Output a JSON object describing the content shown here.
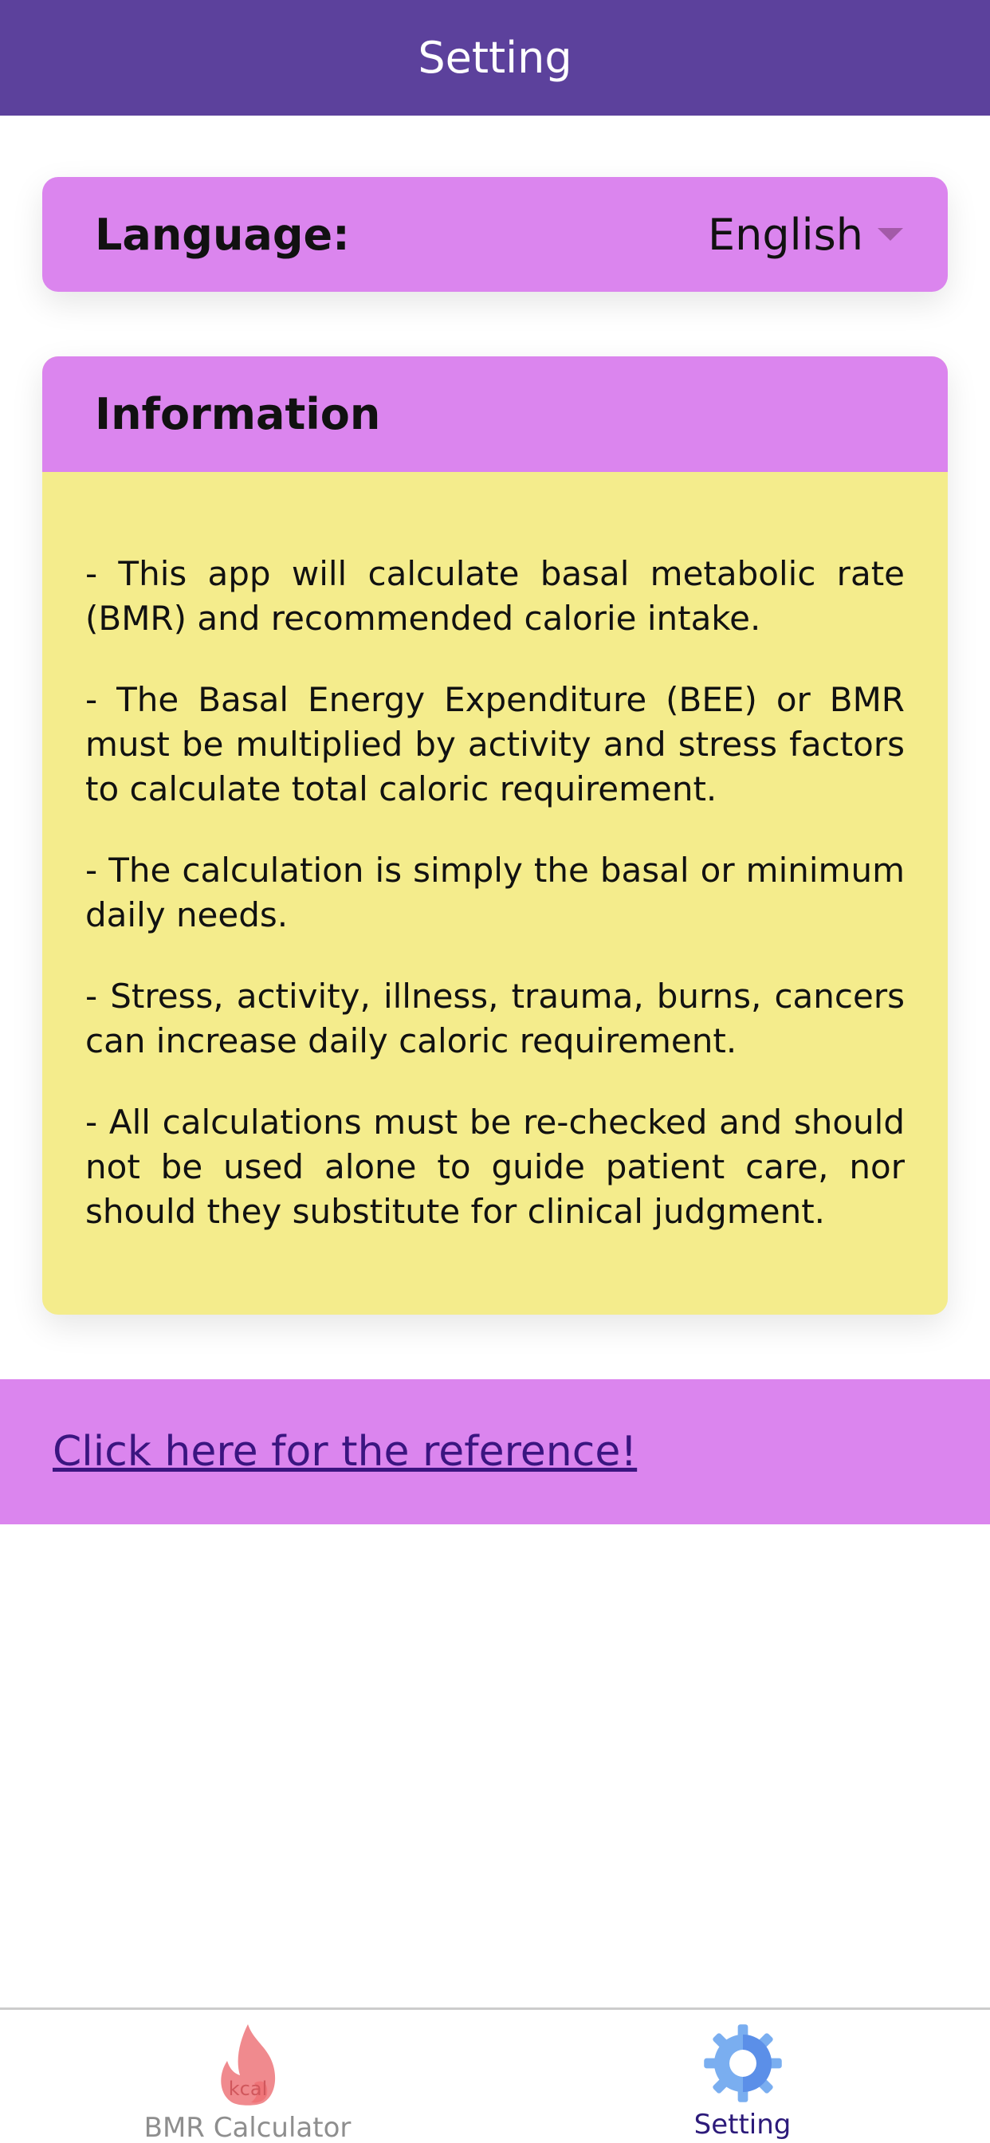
{
  "header": {
    "title": "Setting"
  },
  "language": {
    "label": "Language:",
    "selected": "English",
    "icon": "chevron-down-icon"
  },
  "information": {
    "title": "Information",
    "paragraphs": [
      "- This app will calculate basal metabolic rate (BMR) and recommended calorie intake.",
      "- The Basal Energy Expenditure (BEE) or BMR must be multiplied by activity and stress factors to calculate total caloric requirement.",
      "- The calculation is simply the basal or minimum daily needs.",
      "- Stress, activity, illness, trauma, burns, cancers can increase daily caloric requirement.",
      "- All calculations must be re-checked and should not be used alone to guide patient care, nor should they substitute for clinical judgment."
    ]
  },
  "reference": {
    "link_text": "Click here for the reference!"
  },
  "tabbar": {
    "tabs": [
      {
        "label": "BMR Calculator",
        "icon": "kcal-flame-icon",
        "icon_text": "kcal",
        "active": false
      },
      {
        "label": "Setting",
        "icon": "gear-icon",
        "active": true
      }
    ]
  },
  "colors": {
    "header_bg": "#5c419c",
    "accent_pink": "#db85ee",
    "info_bg": "#f4ec8c",
    "active_tab": "#2c1a7a",
    "inactive_tab": "#8e8e8e"
  }
}
